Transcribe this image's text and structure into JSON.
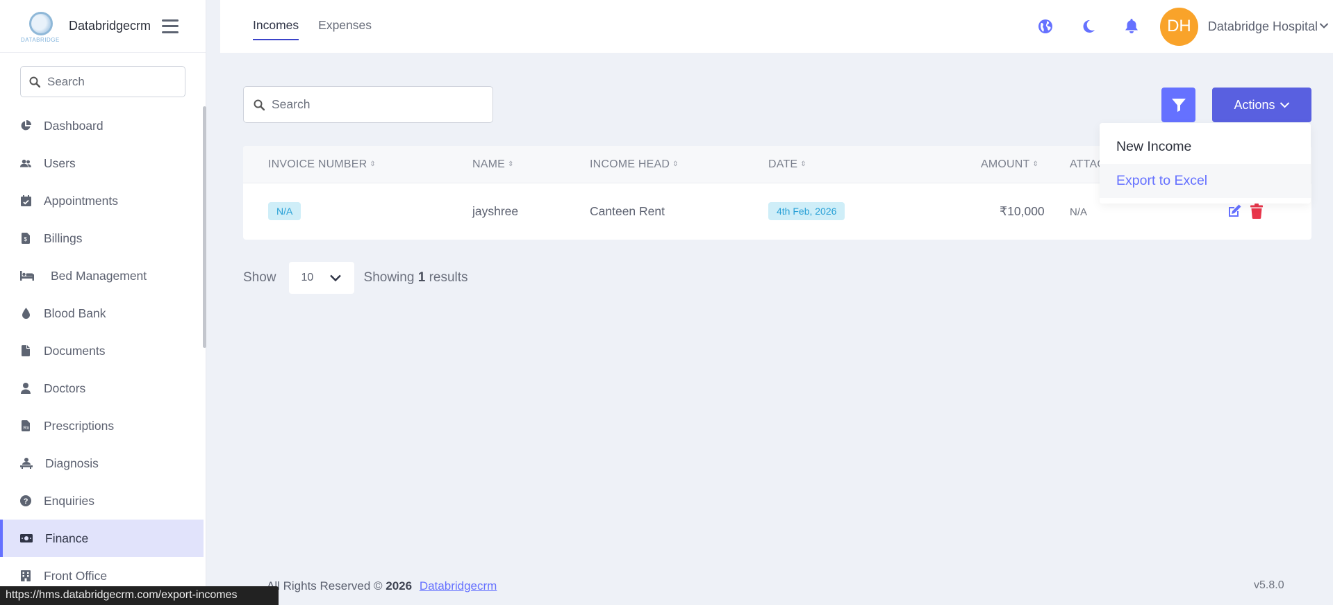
{
  "brand": {
    "name": "Databridgecrm",
    "logo_text": "DATABRIDGE"
  },
  "sidebar": {
    "search_placeholder": "Search",
    "items": [
      {
        "label": "Dashboard",
        "icon": "pie-chart-icon"
      },
      {
        "label": "Users",
        "icon": "users-icon"
      },
      {
        "label": "Appointments",
        "icon": "calendar-check-icon"
      },
      {
        "label": "Billings",
        "icon": "file-invoice-icon"
      },
      {
        "label": "Bed Management",
        "icon": "bed-icon"
      },
      {
        "label": "Blood Bank",
        "icon": "droplet-icon"
      },
      {
        "label": "Documents",
        "icon": "file-icon"
      },
      {
        "label": "Doctors",
        "icon": "doctor-icon"
      },
      {
        "label": "Prescriptions",
        "icon": "prescription-icon"
      },
      {
        "label": "Diagnosis",
        "icon": "diagnosis-icon"
      },
      {
        "label": "Enquiries",
        "icon": "question-circle-icon"
      },
      {
        "label": "Finance",
        "icon": "money-icon",
        "active": true
      },
      {
        "label": "Front Office",
        "icon": "building-icon"
      }
    ]
  },
  "header": {
    "tabs": [
      {
        "label": "Incomes",
        "active": true
      },
      {
        "label": "Expenses",
        "active": false
      }
    ],
    "avatar_initials": "DH",
    "user_name": "Databridge Hospital"
  },
  "toolbar": {
    "search_placeholder": "Search",
    "actions_label": "Actions"
  },
  "dropdown": {
    "items": [
      "New Income",
      "Export to Excel"
    ]
  },
  "table": {
    "columns": [
      "INVOICE NUMBER",
      "NAME",
      "INCOME HEAD",
      "DATE",
      "AMOUNT",
      "ATTAC"
    ],
    "rows": [
      {
        "invoice": "N/A",
        "name": "jayshree",
        "income_head": "Canteen Rent",
        "date": "4th Feb, 2026",
        "amount": "₹10,000",
        "attachment": "N/A"
      }
    ]
  },
  "pagination": {
    "show_label": "Show",
    "per_page": "10",
    "showing_prefix": "Showing",
    "count": "1",
    "showing_suffix": "results"
  },
  "footer": {
    "text": "All Rights Reserved © ",
    "year": "2026",
    "link": "Databridgecrm",
    "version": "v5.8.0"
  },
  "statusbar": {
    "url": "https://hms.databridgecrm.com/export-incomes"
  },
  "colors": {
    "accent": "#6571ff",
    "avatar": "#f9a32a",
    "danger": "#e8354a",
    "badge_bg": "#cfeef8",
    "badge_text": "#28a0d6"
  }
}
